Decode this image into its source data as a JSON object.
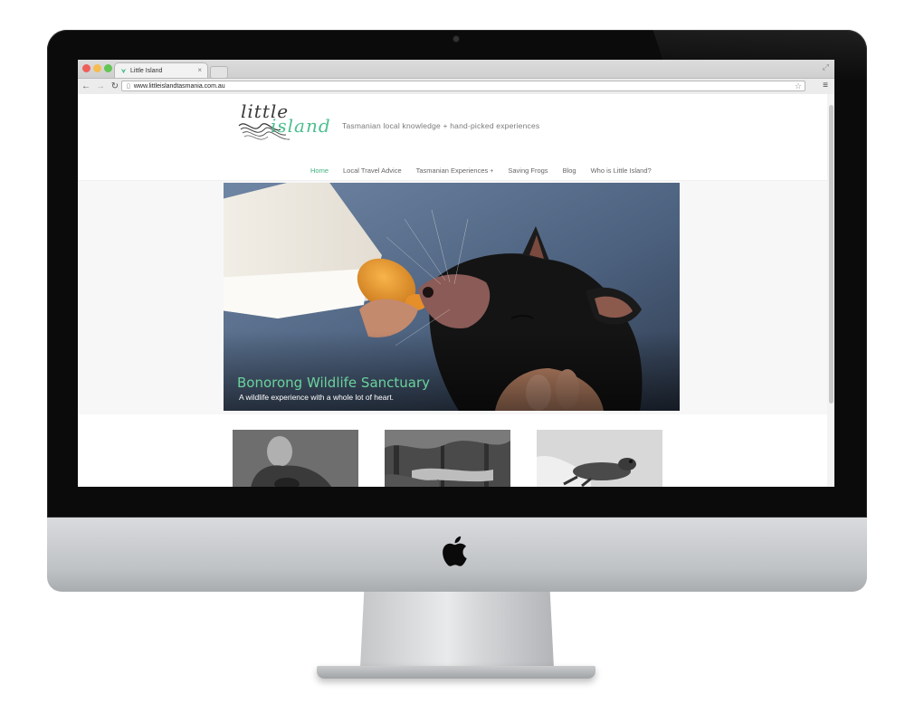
{
  "browser": {
    "tab_title": "Little Island",
    "tab_close": "×",
    "url": "www.littleislandtasmania.com.au",
    "icons": [
      "back-icon",
      "forward-icon",
      "reload-icon",
      "star-icon",
      "menu-icon",
      "page-icon",
      "resize-icon"
    ]
  },
  "site": {
    "logo_top": "little",
    "logo_bottom": "island",
    "tagline": "Tasmanian local knowledge + hand-picked experiences",
    "accent_color": "#3fb07d",
    "nav": [
      {
        "label": "Home"
      },
      {
        "label": "Local Travel Advice"
      },
      {
        "label": "Tasmanian Experiences",
        "submenu": "+"
      },
      {
        "label": "Saving Frogs"
      },
      {
        "label": "Blog"
      },
      {
        "label": "Who is Little Island?"
      }
    ],
    "hero": {
      "title": "Bonorong Wildlife Sanctuary",
      "subtitle": "A wildlife experience with a whole lot of heart."
    }
  }
}
